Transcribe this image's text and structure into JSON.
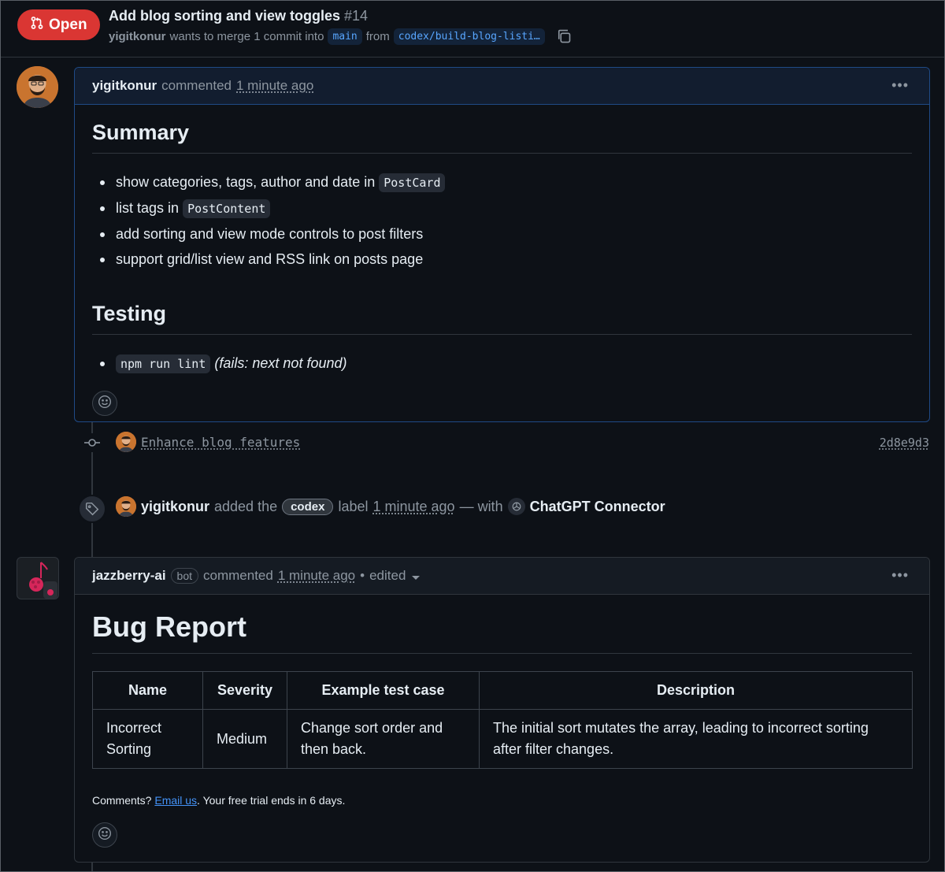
{
  "header": {
    "state_label": "Open",
    "title": "Add blog sorting and view toggles",
    "number": "#14",
    "author": "yigitkonur",
    "merge_text": "wants to merge 1 commit into",
    "base_branch": "main",
    "from_text": "from",
    "head_branch": "codex/build-blog-listi…"
  },
  "comment1": {
    "author": "yigitkonur",
    "action": "commented",
    "time": "1 minute ago",
    "heading_summary": "Summary",
    "summary_items": [
      {
        "text": "show categories, tags, author and date in",
        "code": "PostCard"
      },
      {
        "text": "list tags in",
        "code": "PostContent"
      },
      {
        "text": "add sorting and view mode controls to post filters",
        "code": ""
      },
      {
        "text": "support grid/list view and RSS link on posts page",
        "code": ""
      }
    ],
    "heading_testing": "Testing",
    "testing_code": "npm run lint",
    "testing_note": "(fails: next not found)"
  },
  "commit_event": {
    "message": "Enhance blog features",
    "sha": "2d8e9d3"
  },
  "label_event": {
    "author": "yigitkonur",
    "added_text": "added the",
    "label": "codex",
    "label_text": "label",
    "time": "1 minute ago",
    "with_text": "— with",
    "app": "ChatGPT Connector"
  },
  "comment2": {
    "author": "jazzberry-ai",
    "bot_tag": "bot",
    "action": "commented",
    "time": "1 minute ago",
    "edited": "edited",
    "heading": "Bug Report",
    "table": {
      "headers": [
        "Name",
        "Severity",
        "Example test case",
        "Description"
      ],
      "rows": [
        [
          "Incorrect Sorting",
          "Medium",
          "Change sort order and then back.",
          "The initial sort mutates the array, leading to incorrect sorting after filter changes."
        ]
      ]
    },
    "footer_prefix": "Comments?",
    "footer_link": "Email us",
    "footer_suffix": ". Your free trial ends in 6 days."
  },
  "colors": {
    "background": "#0d1117",
    "open_badge": "#da3633",
    "link": "#4493f8",
    "border": "#30363d"
  }
}
